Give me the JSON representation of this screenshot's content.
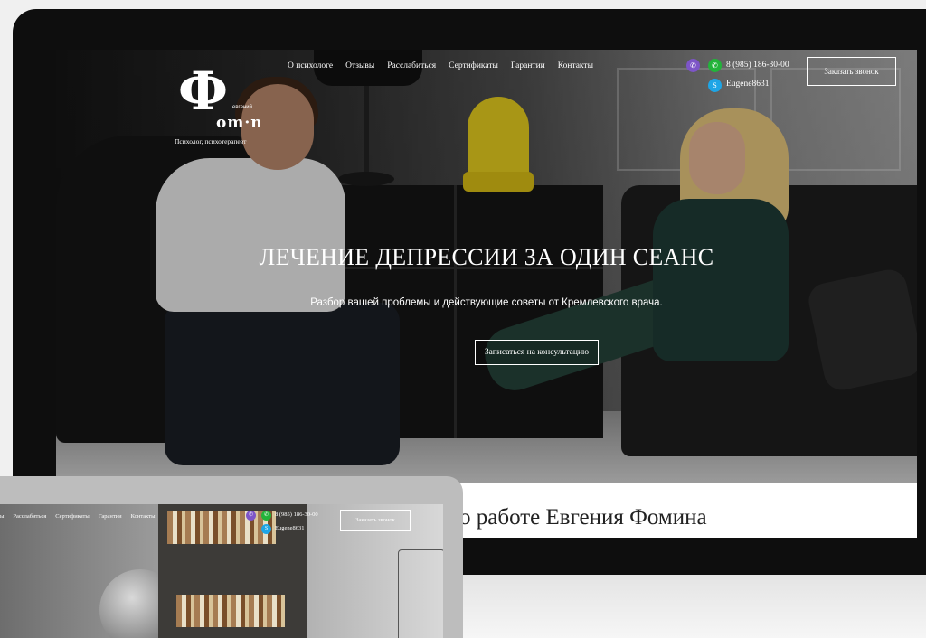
{
  "header": {
    "logo": {
      "mark": "Ф",
      "name": "om·n",
      "first_name": "евгений",
      "tagline": "Психолог, психотерапевт"
    },
    "nav": [
      {
        "label": "О психологе"
      },
      {
        "label": "Отзывы"
      },
      {
        "label": "Расслабиться"
      },
      {
        "label": "Сертификаты"
      },
      {
        "label": "Гарантии"
      },
      {
        "label": "Контакты"
      }
    ],
    "contacts": {
      "phone": "8 (985) 186-30-00",
      "skype": "Eugene8631",
      "viber_icon": "viber-icon",
      "whatsapp_icon": "whatsapp-icon",
      "skype_icon": "skype-icon"
    },
    "call_button": "Заказать звонок"
  },
  "hero": {
    "title": "ЛЕЧЕНИЕ ДЕПРЕССИИ ЗА ОДИН СЕАНС",
    "subtitle": "Разбор вашей проблемы и действующие советы от Кремлевского врача.",
    "cta": "Записаться на консультацию"
  },
  "section": {
    "title": "о работе Евгения Фомина"
  },
  "tablet": {
    "nav": [
      {
        "label": "ы"
      },
      {
        "label": "Расслабиться"
      },
      {
        "label": "Сертификаты"
      },
      {
        "label": "Гарантии"
      },
      {
        "label": "Контакты"
      }
    ],
    "phone": "8 (985) 186-30-00",
    "skype": "Eugene8631",
    "call_button": "Заказать звонок"
  },
  "colors": {
    "viber": "#7d55c7",
    "whatsapp": "#22b33a",
    "skype": "#1ea5e6",
    "bust_yellow": "#e0c91e"
  }
}
